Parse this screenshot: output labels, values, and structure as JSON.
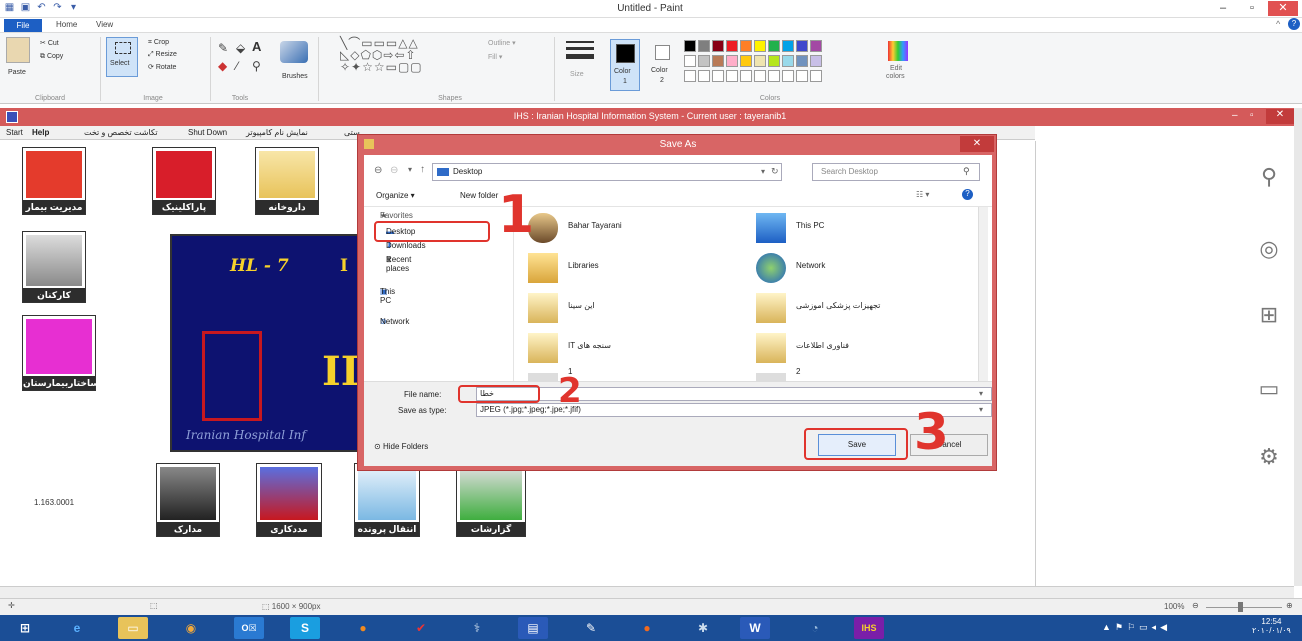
{
  "paint": {
    "title": "Untitled - Paint",
    "tabs": [
      "File",
      "Home",
      "View"
    ],
    "clipboard": {
      "cut": "Cut",
      "copy": "Copy",
      "paste": "Paste",
      "group": "Clipboard"
    },
    "image": {
      "select": "Select",
      "crop": "Crop",
      "resize": "Resize",
      "rotate": "Rotate",
      "group": "Image"
    },
    "tools": {
      "group": "Tools",
      "text_tool": "A"
    },
    "brushes": "Brushes",
    "shapes": {
      "outline": "Outline",
      "fill": "Fill",
      "group": "Shapes"
    },
    "size": "Size",
    "color1": {
      "label": "Color",
      "num": "1"
    },
    "color2": {
      "label": "Color",
      "num": "2"
    },
    "colors_group": "Colors",
    "edit_colors": {
      "line1": "Edit",
      "line2": "colors"
    },
    "palette_row1": [
      "#000000",
      "#7f7f7f",
      "#880015",
      "#ed1c24",
      "#ff7f27",
      "#fff200",
      "#22b14c",
      "#00a2e8",
      "#3f48cc",
      "#a349a4"
    ],
    "palette_row2": [
      "#ffffff",
      "#c3c3c3",
      "#b97a57",
      "#ffaec9",
      "#ffc90e",
      "#efe4b0",
      "#b5e61d",
      "#99d9ea",
      "#7092be",
      "#c8bfe7"
    ],
    "status": {
      "size": "1600 × 900px",
      "zoom": "100%"
    }
  },
  "ihs": {
    "title": "IHS : Iranian Hospital Information System - Current user : tayeranib1",
    "menu": {
      "start": "Start",
      "help": "Help",
      "m1": "تکاشت تخصص و تخت",
      "shutdown": "Shut Down",
      "m2": "نمایش نام کامپیوتر",
      "m3": "ستی"
    },
    "tiles": {
      "manage": "مدیریت بیمار",
      "clinic": "پاراکلینیک",
      "pharmacy": "داروخانه",
      "staff": "کارکنان",
      "building": "ساختاربیمارستان",
      "records": "مدارک پزشکی",
      "social": "مددکاری",
      "transfer": "انتقال پرونده",
      "reports": "گزارشات"
    },
    "banner": {
      "hl7": "HL - 7",
      "hl7_tail": "I",
      "big": "II",
      "subtitle": "Iranian Hospital Inf"
    },
    "version": "1.163.0001"
  },
  "dialog": {
    "title": "Save As",
    "path": "Desktop",
    "search_placeholder": "Search Desktop",
    "organize": "Organize ▾",
    "new_folder": "New folder",
    "nav": {
      "favorites": "Favorites",
      "desktop": "Desktop",
      "downloads": "Downloads",
      "recent": "Recent places",
      "thispc": "This PC",
      "network": "Network"
    },
    "files": [
      {
        "name": "Bahar Tayarani"
      },
      {
        "name": "This PC"
      },
      {
        "name": "Libraries"
      },
      {
        "name": "Network"
      },
      {
        "name": "این سینا"
      },
      {
        "name": "تجهیزات پزشکی اموزشی"
      },
      {
        "name": "IT سنجه های"
      },
      {
        "name": "فناوری اطلاعات"
      },
      {
        "name": "1"
      },
      {
        "name": "2"
      }
    ],
    "file_name_label": "File name:",
    "file_name_value": "خطا",
    "save_type_label": "Save as type:",
    "save_type_value": "JPEG (*.jpg;*.jpeg;*.jpe;*.jfif)",
    "hide_folders": "Hide Folders",
    "save": "Save",
    "cancel": "Cancel"
  },
  "annotations": [
    "1",
    "2",
    "3"
  ],
  "taskbar": {
    "clock_time": "12:54",
    "clock_date": "۲۰۱۰/۰۱/۰۹"
  }
}
